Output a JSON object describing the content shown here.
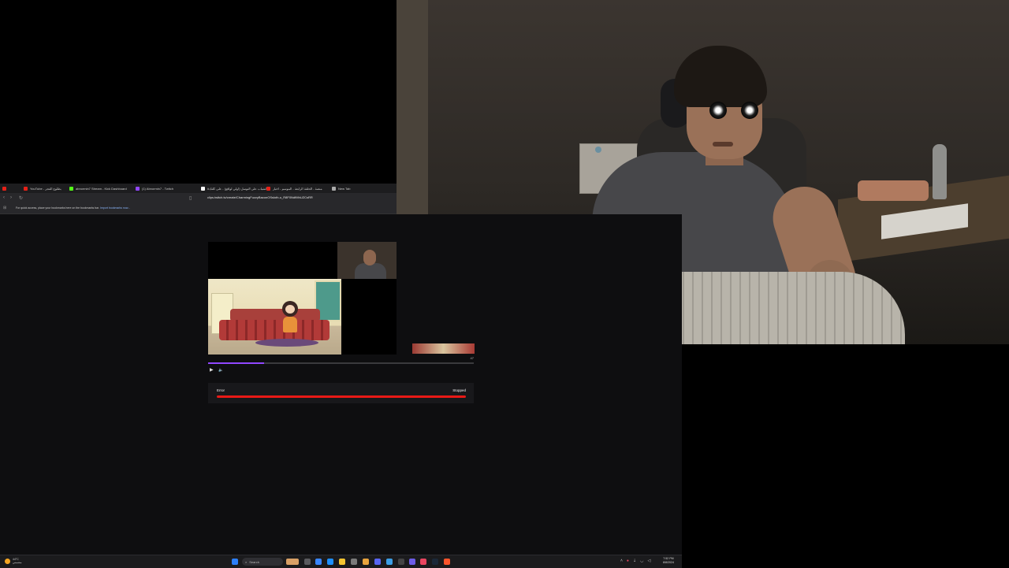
{
  "browser": {
    "tabs": [
      {
        "label": "YouTube - بطلوع الفجر",
        "favicon_color": "#e62117"
      },
      {
        "label": "abnormin7 Stream - Kick Dashboard",
        "favicon_color": "#53fc18"
      },
      {
        "label": "(1) Abnormin7 - Twitch",
        "favicon_color": "#9147ff"
      },
      {
        "label": "#الشباب على التوسل (اولي لواقع) - على كلنك",
        "favicon_color": "#ffffff"
      },
      {
        "label": "منصة - الحلقة الرابعة - الموسم - اخبار",
        "favicon_color": "#e62117"
      },
      {
        "label": "New Tab",
        "favicon_color": "#aaaaaa"
      }
    ],
    "url": "clips.twitch.tv/create/CharmingFuzzyBaconOSsloth-u_R8F0NdfMhUZCsRR",
    "bookmarks_notice": "For quick access, place your bookmarks here on the bookmarks bar.",
    "bookmarks_link": "Import bookmarks now..."
  },
  "player": {
    "timecode": "47",
    "progress_fraction": 0.21,
    "play_icon": "play-icon",
    "volume_icon": "volume-icon"
  },
  "error_panel": {
    "label": "Error",
    "status": "Stopped",
    "bar_color": "#e91916"
  },
  "taskbar": {
    "weather_temp": "44°C",
    "weather_desc": "مشمس",
    "search_label": "Search",
    "clock_time": "7:52 PM",
    "clock_date": "8/8/2024"
  },
  "colors": {
    "accent": "#9147ff",
    "error": "#e91916"
  }
}
